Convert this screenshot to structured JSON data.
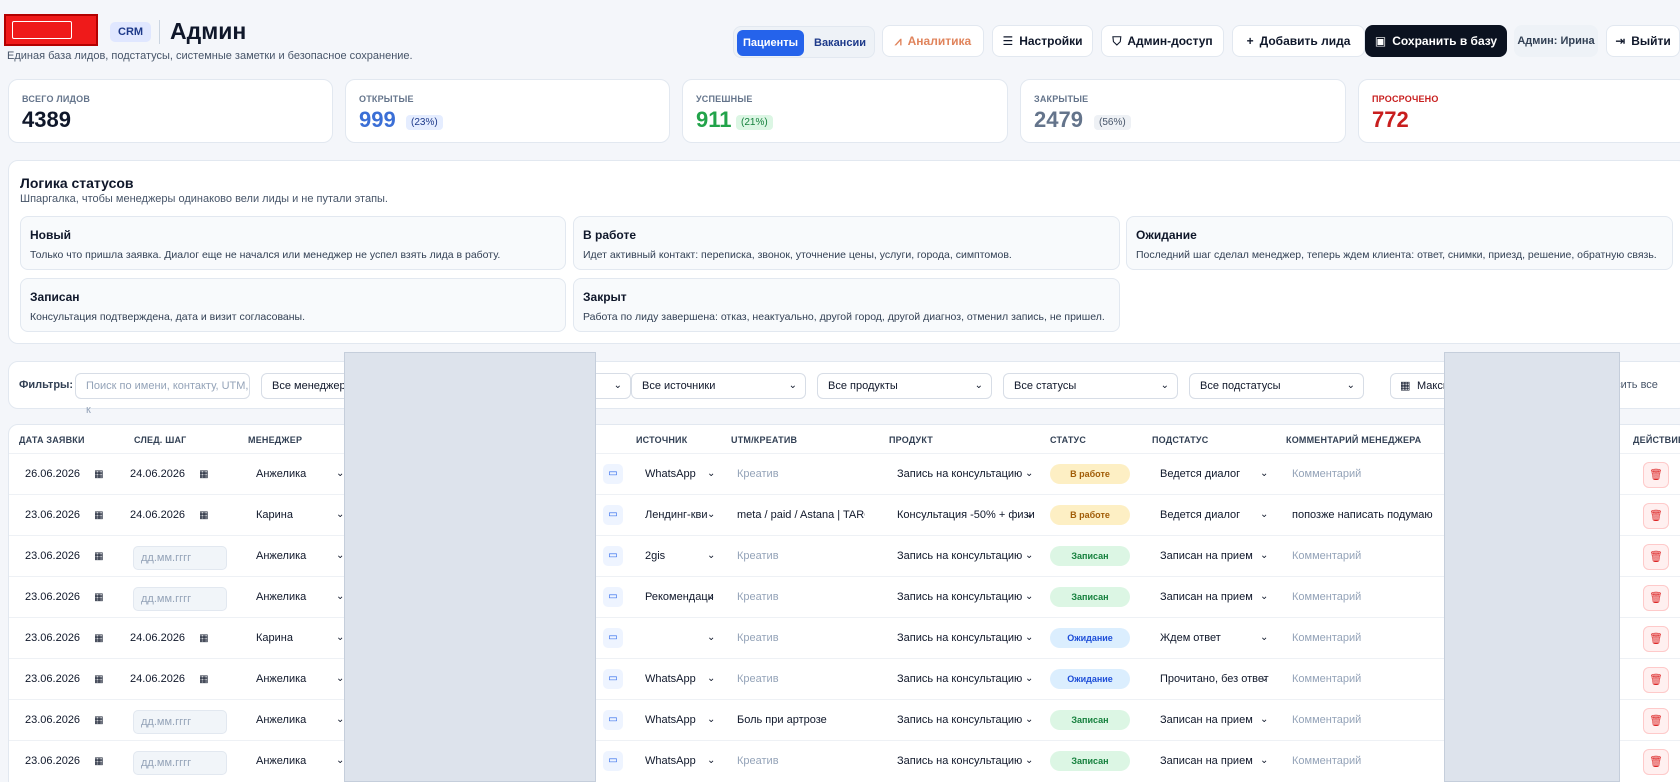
{
  "header": {
    "crm_badge": "CRM",
    "title": "Админ",
    "subtitle": "Единая база лидов, подстатусы, системные заметки и безопасное сохранение.",
    "segments": [
      "Пациенты",
      "Вакансии"
    ],
    "buttons": {
      "analytics": "Аналитика",
      "settings": "Настройки",
      "admin_access": "Админ-доступ",
      "add_lead": "Добавить лида",
      "save": "Сохранить в базу",
      "logout": "Выйти"
    },
    "admin_chip": "Админ: Ирина"
  },
  "stats": [
    {
      "label": "ВСЕГО ЛИДОВ",
      "value": "4389",
      "pct": "",
      "color": "#0f172a"
    },
    {
      "label": "ОТКРЫТЫЕ",
      "value": "999",
      "pct": "(23%)",
      "color": "#3b6fd6"
    },
    {
      "label": "УСПЕШНЫЕ",
      "value": "911",
      "pct": "(21%)",
      "color": "#22a34a"
    },
    {
      "label": "ЗАКРЫТЫЕ",
      "value": "2479",
      "pct": "(56%)",
      "color": "#64748b"
    },
    {
      "label": "ПРОСРОЧЕНО",
      "value": "772",
      "pct": "",
      "color": "#c81e1e"
    }
  ],
  "logic": {
    "title": "Логика статусов",
    "subtitle": "Шпаргалка, чтобы менеджеры одинаково вели лиды и не путали этапы.",
    "items": [
      {
        "title": "Новый",
        "desc": "Только что пришла заявка. Диалог еще не начался или менеджер не успел взять лида в работу."
      },
      {
        "title": "В работе",
        "desc": "Идет активный контакт: переписка, звонок, уточнение цены, услуги, города, симптомов."
      },
      {
        "title": "Ожидание",
        "desc": "Последний шаг сделал менеджер, теперь ждем клиента: ответ, снимки, приезд, решение, обратную связь."
      },
      {
        "title": "Записан",
        "desc": "Консультация подтверждена, дата и визит согласованы."
      },
      {
        "title": "Закрыт",
        "desc": "Работа по лиду завершена: отказ, неактуально, другой город, другой диагноз, отменил запись, не пришел."
      }
    ]
  },
  "filters": {
    "label": "Фильтры:",
    "search_placeholder": "Поиск по имени, контакту, UTM, к",
    "manager": "Все менеджеры",
    "source": "Все источники",
    "product": "Все продукты",
    "status": "Все статусы",
    "substatus": "Все подстатусы",
    "date": "Макси",
    "reset": "осить все"
  },
  "table": {
    "headers": {
      "date": "ДАТА ЗАЯВКИ",
      "next": "СЛЕД. ШАГ",
      "manager": "МЕНЕДЖЕР",
      "source": "ИСТОЧНИК",
      "utm": "UTM/КРЕАТИВ",
      "product": "ПРОДУКТ",
      "status": "СТАТУС",
      "substatus": "ПОДСТАТУС",
      "comment": "КОММЕНТАРИЙ МЕНЕДЖЕРА",
      "action": "ДЕЙСТВИЕ"
    },
    "date_placeholder": "дд.мм.гггг",
    "utm_placeholder": "Креатив",
    "comment_placeholder": "Комментарий",
    "rows": [
      {
        "date": "26.06.2026",
        "next": "24.06.2026",
        "manager": "Анжелика",
        "source": "WhatsApp",
        "utm": "",
        "product": "Запись на консультацию",
        "status": "В работе",
        "status_kind": "work",
        "substatus": "Ведется диалог",
        "comment": ""
      },
      {
        "date": "23.06.2026",
        "next": "24.06.2026",
        "manager": "Карина",
        "source": "Лендинг-кви",
        "utm": "meta / paid / Astana | TARGI",
        "product": "Консультация -50% + физи",
        "status": "В работе",
        "status_kind": "work",
        "substatus": "Ведется диалог",
        "comment": "попозже написать подумаю"
      },
      {
        "date": "23.06.2026",
        "next": "",
        "manager": "Анжелика",
        "source": "2gis",
        "utm": "",
        "product": "Запись на консультацию",
        "status": "Записан",
        "status_kind": "rec",
        "substatus": "Записан на прием",
        "comment": ""
      },
      {
        "date": "23.06.2026",
        "next": "",
        "manager": "Анжелика",
        "source": "Рекомендаци",
        "utm": "",
        "product": "Запись на консультацию",
        "status": "Записан",
        "status_kind": "rec",
        "substatus": "Записан на прием",
        "comment": ""
      },
      {
        "date": "23.06.2026",
        "next": "24.06.2026",
        "manager": "Карина",
        "source": "",
        "utm": "",
        "product": "Запись на консультацию",
        "status": "Ожидание",
        "status_kind": "wait",
        "substatus": "Ждем ответ",
        "comment": ""
      },
      {
        "date": "23.06.2026",
        "next": "24.06.2026",
        "manager": "Анжелика",
        "source": "WhatsApp",
        "utm": "",
        "product": "Запись на консультацию",
        "status": "Ожидание",
        "status_kind": "wait",
        "substatus": "Прочитано, без ответ",
        "comment": ""
      },
      {
        "date": "23.06.2026",
        "next": "",
        "manager": "Анжелика",
        "source": "WhatsApp",
        "utm": "Боль при артрозе",
        "product": "Запись на консультацию",
        "status": "Записан",
        "status_kind": "rec",
        "substatus": "Записан на прием",
        "comment": ""
      },
      {
        "date": "23.06.2026",
        "next": "",
        "manager": "Анжелика",
        "source": "WhatsApp",
        "utm": "",
        "product": "Запись на консультацию",
        "status": "Записан",
        "status_kind": "rec",
        "substatus": "Записан на прием",
        "comment": ""
      }
    ]
  }
}
